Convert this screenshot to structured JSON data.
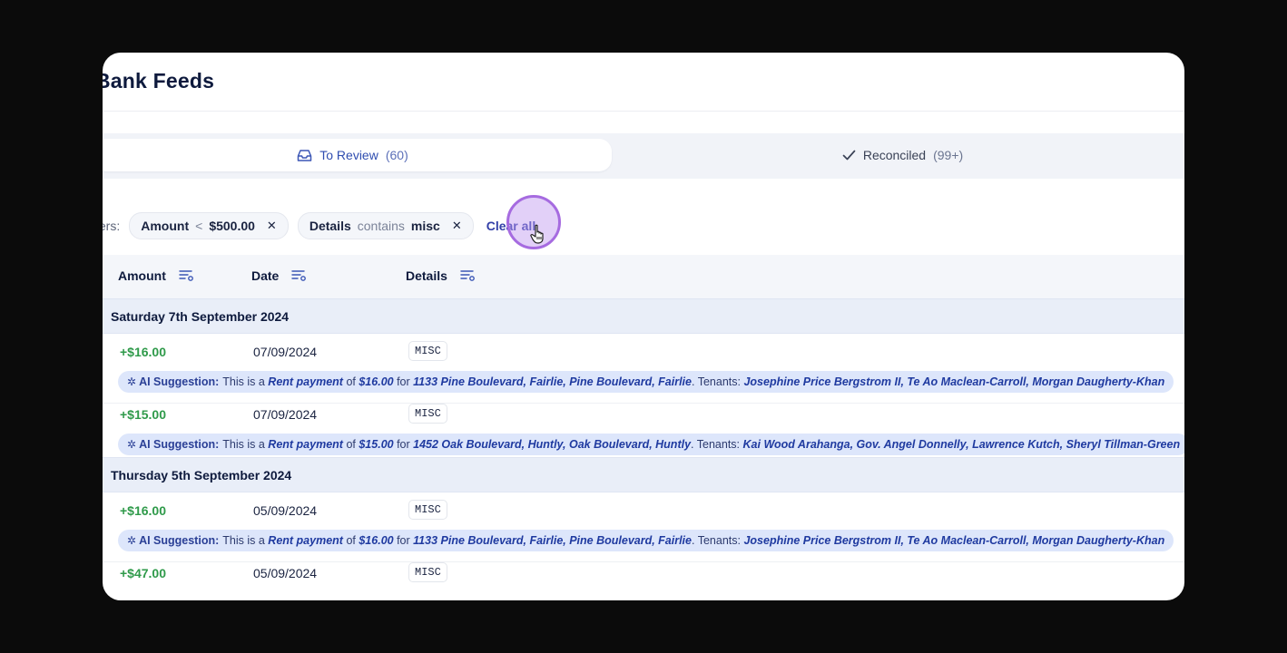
{
  "page": {
    "title": "Bank Feeds"
  },
  "tabs": [
    {
      "label": "To Review",
      "count": "(60)",
      "icon": "inbox-icon"
    },
    {
      "label": "Reconciled",
      "count": "(99+)",
      "icon": "check-icon"
    }
  ],
  "filters": {
    "label": "ters:",
    "chips": [
      {
        "field": "Amount",
        "operator": "<",
        "value": "$500.00",
        "remove": "✕"
      },
      {
        "field": "Details",
        "operator": "contains",
        "value": "misc",
        "remove": "✕"
      }
    ],
    "clear_label": "Clear all"
  },
  "table": {
    "columns": [
      "Amount",
      "Date",
      "Details"
    ],
    "groups": [
      {
        "label": "Saturday 7th September 2024"
      },
      {
        "label": "Thursday 5th September 2024"
      }
    ],
    "rows": [
      {
        "amount": "+$16.00",
        "date": "07/09/2024",
        "details": "MISC",
        "ai": {
          "label": "AI Suggestion:",
          "t1": "This is a",
          "type": "Rent payment",
          "t2": "of",
          "amount": "$16.00",
          "t3": "for",
          "address": "1133 Pine Boulevard, Fairlie, Pine Boulevard, Fairlie",
          "t4": ". Tenants:",
          "tenants": "Josephine Price Bergstrom II, Te Ao Maclean-Carroll, Morgan Daugherty-Khan"
        }
      },
      {
        "amount": "+$15.00",
        "date": "07/09/2024",
        "details": "MISC",
        "ai": {
          "label": "AI Suggestion:",
          "t1": "This is a",
          "type": "Rent payment",
          "t2": "of",
          "amount": "$15.00",
          "t3": "for",
          "address": "1452 Oak Boulevard, Huntly, Oak Boulevard, Huntly",
          "t4": ". Tenants:",
          "tenants": "Kai Wood Arahanga, Gov. Angel Donnelly, Lawrence Kutch, Sheryl Tillman-Green"
        }
      },
      {
        "amount": "+$16.00",
        "date": "05/09/2024",
        "details": "MISC",
        "ai": {
          "label": "AI Suggestion:",
          "t1": "This is a",
          "type": "Rent payment",
          "t2": "of",
          "amount": "$16.00",
          "t3": "for",
          "address": "1133 Pine Boulevard, Fairlie, Pine Boulevard, Fairlie",
          "t4": ". Tenants:",
          "tenants": "Josephine Price Bergstrom II, Te Ao Maclean-Carroll, Morgan Daugherty-Khan"
        }
      },
      {
        "amount": "+$47.00",
        "date": "05/09/2024",
        "details": "MISC"
      }
    ]
  },
  "colors": {
    "accent": "#2f4db0",
    "positive": "#2f9a4a",
    "ai_bg": "#dde6fb",
    "cursor": "#a66be0"
  }
}
